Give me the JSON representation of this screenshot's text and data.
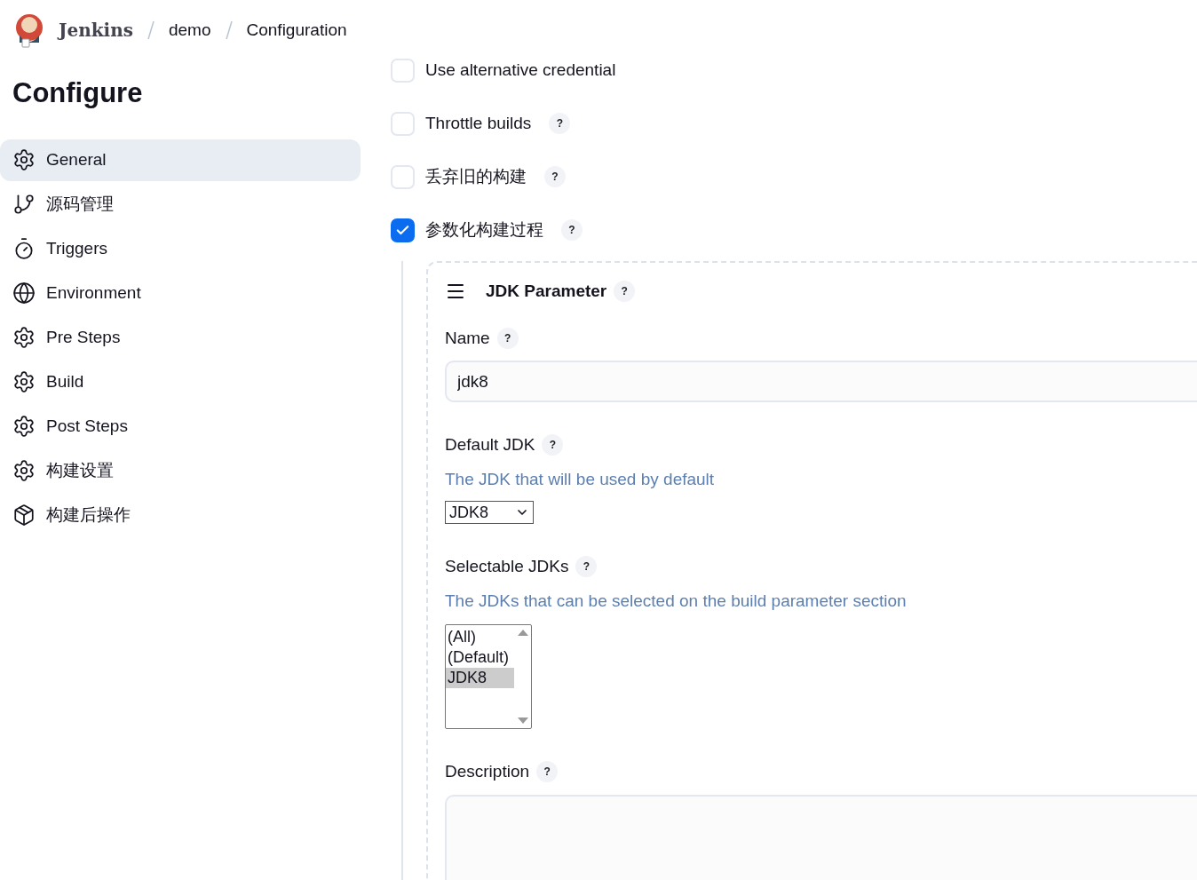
{
  "breadcrumb": [
    "Jenkins",
    "demo",
    "Configuration"
  ],
  "page_title": "Configure",
  "sidebar": {
    "items": [
      {
        "label": "General",
        "selected": true
      },
      {
        "label": "源码管理",
        "selected": false
      },
      {
        "label": "Triggers",
        "selected": false
      },
      {
        "label": "Environment",
        "selected": false
      },
      {
        "label": "Pre Steps",
        "selected": false
      },
      {
        "label": "Build",
        "selected": false
      },
      {
        "label": "Post Steps",
        "selected": false
      },
      {
        "label": "构建设置",
        "selected": false
      },
      {
        "label": "构建后操作",
        "selected": false
      }
    ]
  },
  "options": [
    {
      "label": "Use alternative credential",
      "checked": false,
      "help": false
    },
    {
      "label": "Throttle builds",
      "checked": false,
      "help": true
    },
    {
      "label": "丢弃旧的构建",
      "checked": false,
      "help": true
    },
    {
      "label": "参数化构建过程",
      "checked": true,
      "help": true
    }
  ],
  "parameter": {
    "title": "JDK Parameter",
    "name": {
      "label": "Name",
      "value": "jdk8"
    },
    "default_jdk": {
      "label": "Default JDK",
      "description": "The JDK that will be used by default",
      "value": "JDK8"
    },
    "selectable_jdks": {
      "label": "Selectable JDKs",
      "description": "The JDKs that can be selected on the build parameter section",
      "options": [
        {
          "label": "(All)",
          "selected": false
        },
        {
          "label": "(Default)",
          "selected": false
        },
        {
          "label": "JDK8",
          "selected": true
        }
      ]
    },
    "description": {
      "label": "Description"
    }
  },
  "help_mark": "?"
}
